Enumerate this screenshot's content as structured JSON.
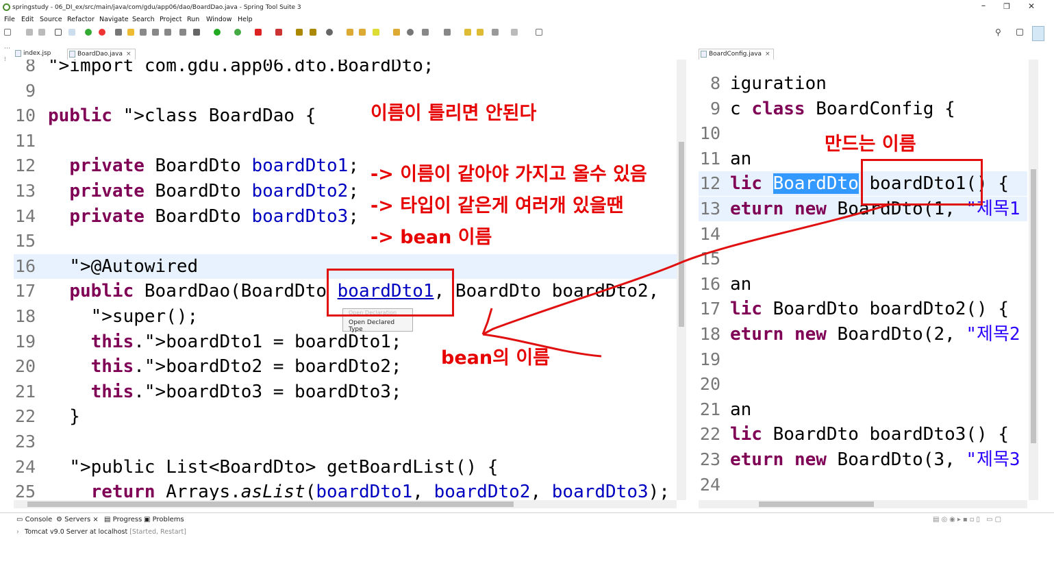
{
  "window": {
    "title": "springstudy - 06_DI_ex/src/main/java/com/gdu/app06/dao/BoardDao.java - Spring Tool Suite 3",
    "minimize": "–",
    "maximize": "❐",
    "close": "✕"
  },
  "menu": [
    "File",
    "Edit",
    "Source",
    "Refactor",
    "Navigate",
    "Search",
    "Project",
    "Run",
    "Window",
    "Help"
  ],
  "toolbar": {
    "quick_access_icon": "search-icon"
  },
  "tabs_left": [
    {
      "label": "index.jsp",
      "active": false
    },
    {
      "label": "BoardDao.java",
      "active": true,
      "close": "×"
    }
  ],
  "tabs_right": [
    {
      "label": "BoardConfig.java",
      "active": true,
      "close": "×"
    }
  ],
  "left_editor": {
    "lines": [
      {
        "n": "8",
        "text": "import com.gdu.app06.dto.BoardDto;"
      },
      {
        "n": "9",
        "text": ""
      },
      {
        "n": "10",
        "text": "public class BoardDao {"
      },
      {
        "n": "11",
        "text": ""
      },
      {
        "n": "12",
        "text": "  private BoardDto boardDto1;"
      },
      {
        "n": "13",
        "text": "  private BoardDto boardDto2;"
      },
      {
        "n": "14",
        "text": "  private BoardDto boardDto3;"
      },
      {
        "n": "15",
        "text": ""
      },
      {
        "n": "16",
        "text": "  @Autowired"
      },
      {
        "n": "17",
        "text": "  public BoardDao(BoardDto boardDto1, BoardDto boardDto2,"
      },
      {
        "n": "18",
        "text": "    super();"
      },
      {
        "n": "19",
        "text": "    this.boardDto1 = boardDto1;"
      },
      {
        "n": "20",
        "text": "    this.boardDto2 = boardDto2;"
      },
      {
        "n": "21",
        "text": "    this.boardDto3 = boardDto3;"
      },
      {
        "n": "22",
        "text": "  }"
      },
      {
        "n": "23",
        "text": ""
      },
      {
        "n": "24",
        "text": "  public List<BoardDto> getBoardList() {"
      },
      {
        "n": "25",
        "text": "    return Arrays.asList(boardDto1, boardDto2, boardDto3);"
      }
    ]
  },
  "right_editor": {
    "lines": [
      {
        "n": "8",
        "text": "iguration"
      },
      {
        "n": "9",
        "text": "c class BoardConfig {"
      },
      {
        "n": "10",
        "text": ""
      },
      {
        "n": "11",
        "text": "an"
      },
      {
        "n": "12",
        "text": "lic BoardDto boardDto1() {"
      },
      {
        "n": "13",
        "text": "eturn new BoardDto(1, \"제목1"
      },
      {
        "n": "14",
        "text": ""
      },
      {
        "n": "15",
        "text": ""
      },
      {
        "n": "16",
        "text": "an"
      },
      {
        "n": "17",
        "text": "lic BoardDto boardDto2() {"
      },
      {
        "n": "18",
        "text": "eturn new BoardDto(2, \"제목2"
      },
      {
        "n": "19",
        "text": ""
      },
      {
        "n": "20",
        "text": ""
      },
      {
        "n": "21",
        "text": "an"
      },
      {
        "n": "22",
        "text": "lic BoardDto boardDto3() {"
      },
      {
        "n": "23",
        "text": "eturn new BoardDto(3, \"제목3"
      },
      {
        "n": "24",
        "text": ""
      }
    ]
  },
  "context_menu": {
    "item1": "Open Declaration",
    "item2": "Open Declared Type"
  },
  "annotations": {
    "title": "이름이 틀리면 안된다",
    "line1": "-> 이름이 같아야 가지고 올수 있음",
    "line2": "-> 타입이 같은게 여러개 있을땐",
    "line3": "-> bean 이름",
    "bean_name": "bean의 이름",
    "make_name": "만드는 이름",
    "color": "#e60000"
  },
  "bottom_panel": {
    "tabs": [
      "Console",
      "Servers",
      "Progress",
      "Problems"
    ],
    "server": "Tomcat v9.0 Server at localhost",
    "server_status": "[Started, Restart]"
  }
}
